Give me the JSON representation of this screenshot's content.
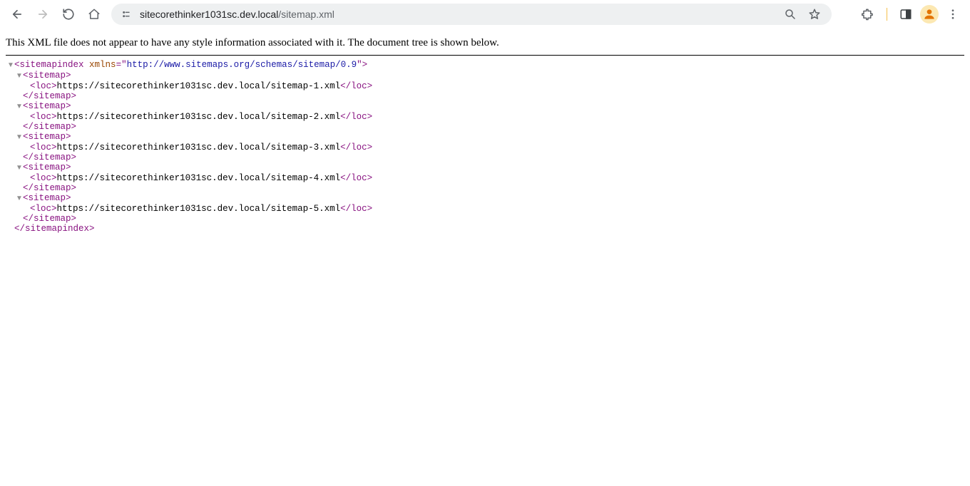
{
  "browser": {
    "url_host": "sitecorethinker1031sc.dev.local",
    "url_path": "/sitemap.xml"
  },
  "notice": "This XML file does not appear to have any style information associated with it. The document tree is shown below.",
  "xml": {
    "root_tag": "sitemapindex",
    "root_attr_name": "xmlns",
    "root_attr_value": "http://www.sitemaps.org/schemas/sitemap/0.9",
    "sitemap_tag": "sitemap",
    "loc_tag": "loc",
    "entries": [
      "https://sitecorethinker1031sc.dev.local/sitemap-1.xml",
      "https://sitecorethinker1031sc.dev.local/sitemap-2.xml",
      "https://sitecorethinker1031sc.dev.local/sitemap-3.xml",
      "https://sitecorethinker1031sc.dev.local/sitemap-4.xml",
      "https://sitecorethinker1031sc.dev.local/sitemap-5.xml"
    ]
  }
}
